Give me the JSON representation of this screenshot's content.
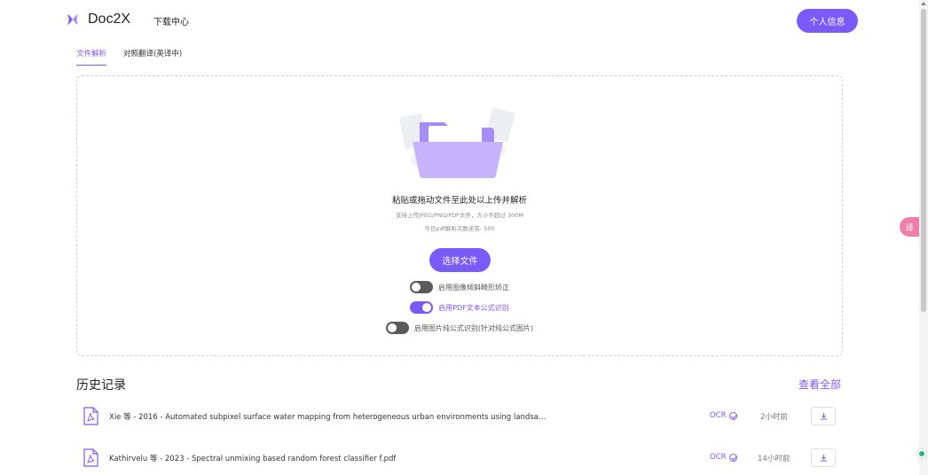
{
  "header": {
    "app_name": "Doc2X",
    "download_center": "下载中心",
    "profile_button": "个人信息"
  },
  "tabs": [
    {
      "label": "文件解析",
      "active": true
    },
    {
      "label": "对照翻译(英译中)",
      "active": false
    }
  ],
  "upload": {
    "title": "粘贴或拖动文件至此处以上传并解析",
    "supported": "支持上传JPEG/PNG/PDF文件，大小不超过 300M",
    "quota": "今日pdf解析次数还有: 500",
    "choose_button": "选择文件",
    "toggles": [
      {
        "label": "启用图像倾斜畸形矫正",
        "on": false
      },
      {
        "label": "启用PDF文本公式识别",
        "on": true
      },
      {
        "label": "启用图片纯公式识别(针对纯公式图片)",
        "on": false
      }
    ]
  },
  "history": {
    "title": "历史记录",
    "view_all": "查看全部",
    "items": [
      {
        "name": "Xie 等 - 2016 - Automated subpixel surface water mapping from heterogeneous urban environments using landsa…",
        "status": "OCR",
        "time": "2小时前"
      },
      {
        "name": "Kathirvelu 等 - 2023 - Spectral unmixing based random forest classifier f.pdf",
        "status": "OCR",
        "time": "14小时前"
      }
    ]
  },
  "side_tool": {
    "label": "译"
  },
  "colors": {
    "accent": "#7a5af8",
    "side_tool": "#f07ea6",
    "online": "#25b67a"
  },
  "icons": [
    "doc2x-logo-icon",
    "folder-illustration-icon",
    "pdf-file-icon",
    "download-icon",
    "check-circle-icon",
    "translate-icon"
  ]
}
